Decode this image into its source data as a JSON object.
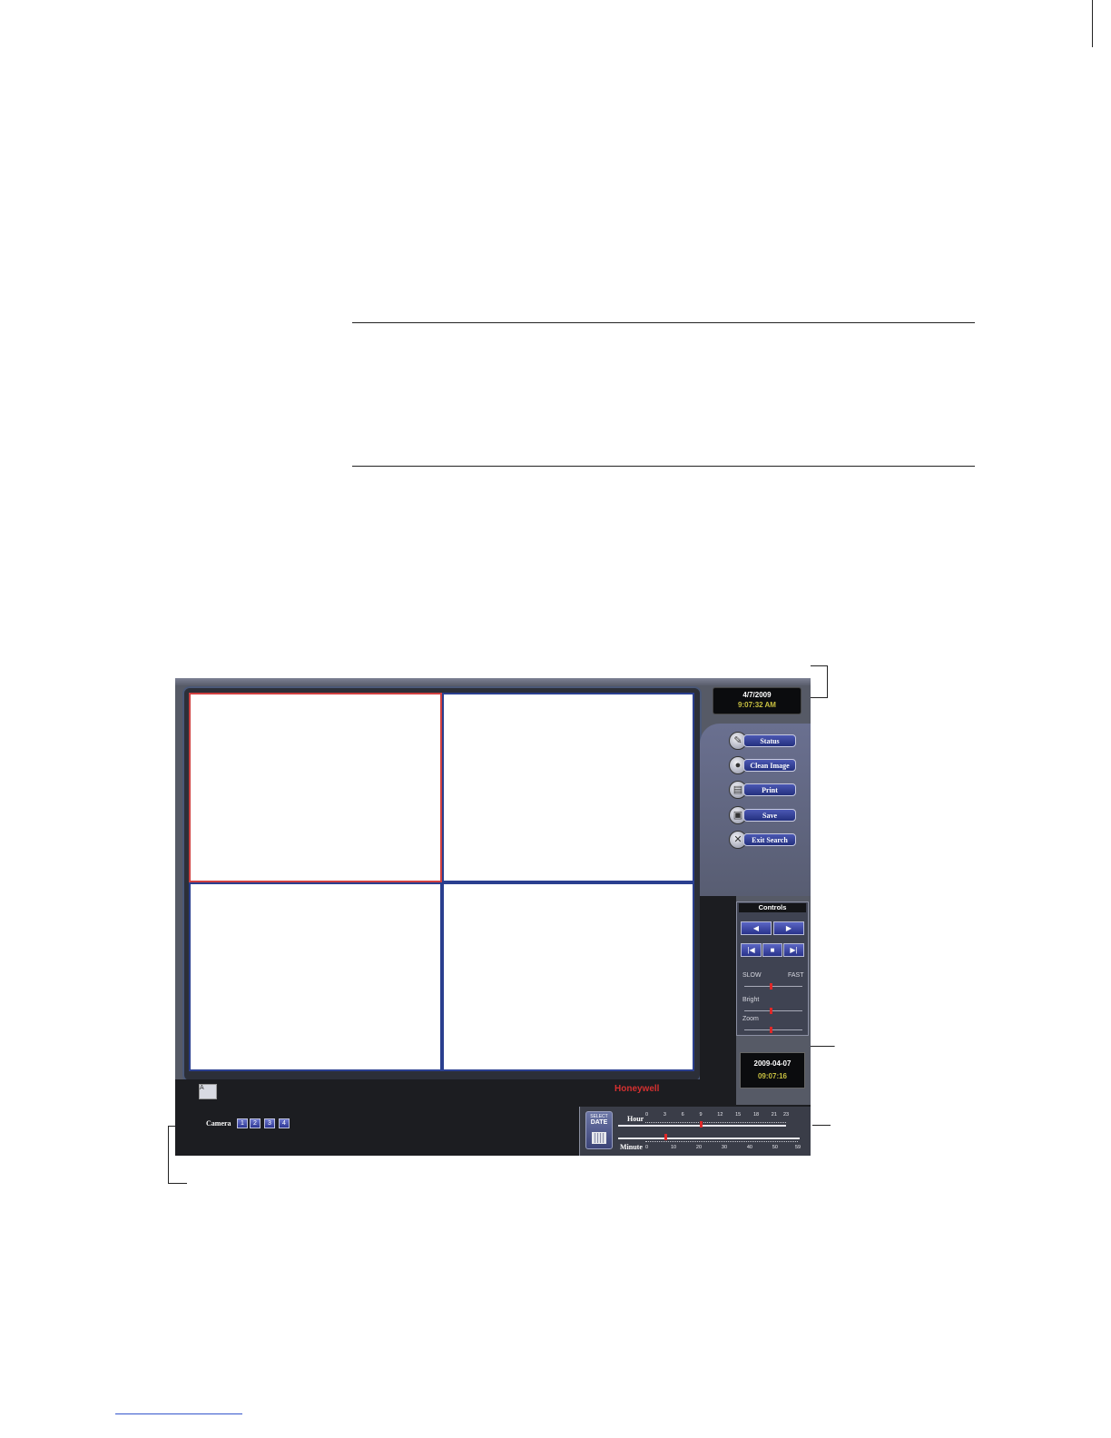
{
  "window": {
    "top_clock": {
      "date": "4/7/2009",
      "time": "9:07:32 AM"
    },
    "side_buttons": [
      {
        "label": "Status",
        "icon": "wrench-icon"
      },
      {
        "label": "Clean Image",
        "icon": "clean-icon"
      },
      {
        "label": "Print",
        "icon": "printer-icon"
      },
      {
        "label": "Save",
        "icon": "disk-icon"
      },
      {
        "label": "Exit Search",
        "icon": "exit-icon"
      }
    ],
    "controls": {
      "title": "Controls",
      "play_back": "◀",
      "play_forward": "▶",
      "skip_start": "|◀",
      "stop": "■",
      "skip_end": "▶|",
      "speed_slow_label": "SLOW",
      "speed_fast_label": "FAST",
      "bright_label": "Bright",
      "zoom_label": "Zoom"
    },
    "playback_clock": {
      "date": "2009-04-07",
      "time": "09:07:16"
    },
    "brand": "Honeywell",
    "layout_icon": "A",
    "camera_label": "Camera",
    "cameras": [
      "1",
      "2",
      "3",
      "4"
    ],
    "select_date": {
      "line1": "SELECT",
      "line2": "DATE"
    },
    "hour_label": "Hour",
    "minute_label": "Minute",
    "hour_ticks": [
      "0",
      "3",
      "6",
      "9",
      "12",
      "15",
      "18",
      "21",
      "23"
    ],
    "minute_ticks": [
      "0",
      "10",
      "20",
      "30",
      "40",
      "50",
      "59"
    ],
    "hour_value": 9,
    "minute_value": 7
  },
  "colors": {
    "selected_cell_border": "#d04040",
    "cell_border": "#2a3f8f",
    "brand": "#d43030",
    "marker": "#e02828"
  }
}
